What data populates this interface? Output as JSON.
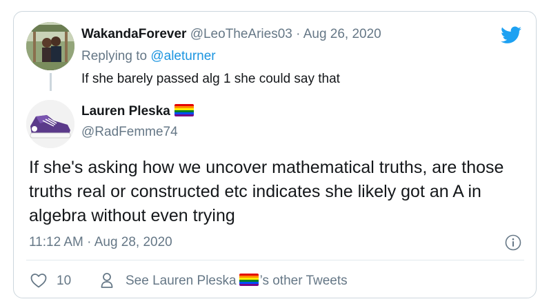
{
  "parent_tweet": {
    "display_name": "WakandaForever",
    "handle": "@LeoTheAries03",
    "separator": " · ",
    "date": "Aug 26, 2020",
    "replying_prefix": "Replying to ",
    "replying_to": "@aleturner",
    "text": "If she barely passed alg 1 she could say that"
  },
  "tweet": {
    "display_name": "Lauren Pleska",
    "handle": "@RadFemme74",
    "text": "If she's asking how we uncover mathematical truths, are those truths real or constructed etc indicates she likely got an A in algebra without even trying",
    "timestamp": "11:12 AM · Aug 28, 2020"
  },
  "actions": {
    "like_count": "10",
    "see_prefix": "See Lauren Pleska",
    "see_suffix": "’s other Tweets"
  },
  "icons": {
    "brand": "twitter-bird-icon",
    "info": "info-icon",
    "like": "heart-icon",
    "profile": "person-icon",
    "emoji": "rainbow-flag-icon"
  },
  "colors": {
    "twitter_blue": "#1da1f2",
    "link_blue": "#1b95e0",
    "secondary_text": "#657786",
    "border": "#ccd6dd"
  }
}
